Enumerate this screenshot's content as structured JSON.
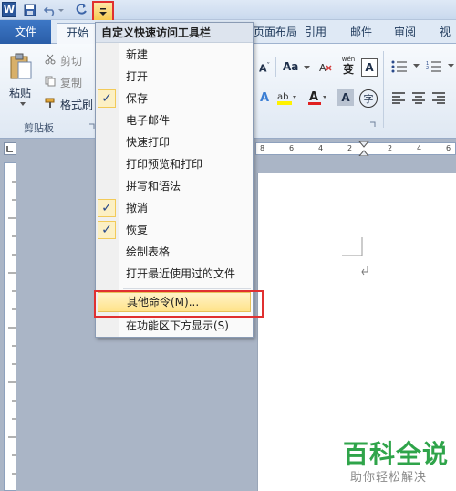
{
  "qat": {
    "app_icon": "W",
    "dropdown_icon": "customize-qat-arrow"
  },
  "tabs": {
    "file": "文件",
    "home": "开始",
    "layout": "页面布局",
    "references": "引用",
    "mailings": "邮件",
    "review": "审阅",
    "view": "视图"
  },
  "ribbon": {
    "paste": "粘贴",
    "cut": "剪切",
    "copy": "复制",
    "format_painter": "格式刷",
    "clipboard_group": "剪贴板",
    "font_aa": "Aa",
    "pinyin": "wén",
    "pinyin_char": "变"
  },
  "menu": {
    "title": "自定义快速访问工具栏",
    "items": [
      {
        "label": "新建",
        "checked": false
      },
      {
        "label": "打开",
        "checked": false
      },
      {
        "label": "保存",
        "checked": true
      },
      {
        "label": "电子邮件",
        "checked": false
      },
      {
        "label": "快速打印",
        "checked": false
      },
      {
        "label": "打印预览和打印",
        "checked": false
      },
      {
        "label": "拼写和语法",
        "checked": false
      },
      {
        "label": "撤消",
        "checked": true
      },
      {
        "label": "恢复",
        "checked": true
      },
      {
        "label": "绘制表格",
        "checked": false
      },
      {
        "label": "打开最近使用过的文件",
        "checked": false
      }
    ],
    "more_commands": "其他命令(M)...",
    "show_below": "在功能区下方显示(S)"
  },
  "ruler": {
    "ticks": [
      "8",
      "6",
      "4",
      "2",
      "2",
      "4",
      "6"
    ]
  },
  "watermark": {
    "title": "百科全说",
    "subtitle": "助你轻松解决"
  }
}
